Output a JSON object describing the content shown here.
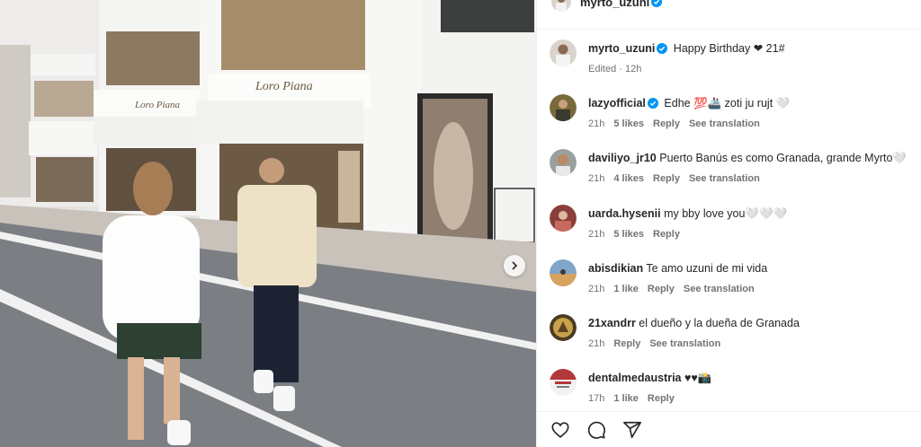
{
  "post": {
    "author": "myrto_uzuni",
    "caption": "Happy Birthday ❤︎ 21#",
    "edited": "Edited · 12h"
  },
  "photo": {
    "store_sign_1": "Loro Piana",
    "store_sign_2": "Loro Piana",
    "alt_subject": "couple-on-street"
  },
  "comments": [
    {
      "user": "lazyofficial",
      "verified": true,
      "text": "Edhe 💯🚢 zoti ju rujt 🤍",
      "time": "21h",
      "likes": "5 likes",
      "reply": "Reply",
      "translate": "See translation",
      "avatar_color": "#7a6a3a"
    },
    {
      "user": "daviliyo_jr10",
      "verified": false,
      "text": "Puerto Banús es como Granada, grande Myrto🤍",
      "time": "21h",
      "likes": "4 likes",
      "reply": "Reply",
      "translate": "See translation",
      "avatar_color": "#9aa19c"
    },
    {
      "user": "uarda.hysenii",
      "verified": false,
      "text": "my bby love you🤍🤍🤍",
      "time": "21h",
      "likes": "5 likes",
      "reply": "Reply",
      "translate": "",
      "avatar_color": "#8b3f3a"
    },
    {
      "user": "abisdikian",
      "verified": false,
      "text": "Te amo uzuni de mi vida",
      "time": "21h",
      "likes": "1 like",
      "reply": "Reply",
      "translate": "See translation",
      "avatar_color": "#d7a35e"
    },
    {
      "user": "21xandrr",
      "verified": false,
      "text": "el dueño y la dueña de Granada",
      "time": "21h",
      "likes": "",
      "reply": "Reply",
      "translate": "See translation",
      "avatar_color": "#c9a14a"
    },
    {
      "user": "dentalmedaustria",
      "verified": false,
      "text": "♥♥📸",
      "time": "17h",
      "likes": "1 like",
      "reply": "Reply",
      "translate": "",
      "avatar_color": "#b2383a"
    }
  ],
  "icons": {
    "verified": "verified-badge-icon",
    "like": "heart-icon",
    "comment": "comment-icon",
    "share": "share-icon",
    "next": "chevron-right-icon"
  },
  "colors": {
    "verified_blue": "#0095f6",
    "meta_gray": "#737373"
  }
}
